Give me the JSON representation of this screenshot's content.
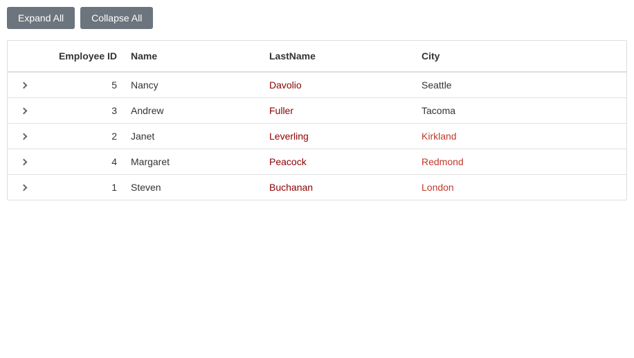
{
  "toolbar": {
    "expand_all_label": "Expand All",
    "collapse_all_label": "Collapse All"
  },
  "grid": {
    "headers": [
      {
        "key": "expand",
        "label": ""
      },
      {
        "key": "employee_id",
        "label": "Employee ID"
      },
      {
        "key": "name",
        "label": "Name"
      },
      {
        "key": "lastname",
        "label": "LastName"
      },
      {
        "key": "city",
        "label": "City"
      }
    ],
    "rows": [
      {
        "id": 5,
        "name": "Nancy",
        "lastname": "Davolio",
        "city": "Seattle",
        "city_color": "normal"
      },
      {
        "id": 3,
        "name": "Andrew",
        "lastname": "Fuller",
        "city": "Tacoma",
        "city_color": "normal"
      },
      {
        "id": 2,
        "name": "Janet",
        "lastname": "Leverling",
        "city": "Kirkland",
        "city_color": "red"
      },
      {
        "id": 4,
        "name": "Margaret",
        "lastname": "Peacock",
        "city": "Redmond",
        "city_color": "red"
      },
      {
        "id": 1,
        "name": "Steven",
        "lastname": "Buchanan",
        "city": "London",
        "city_color": "red"
      }
    ]
  }
}
